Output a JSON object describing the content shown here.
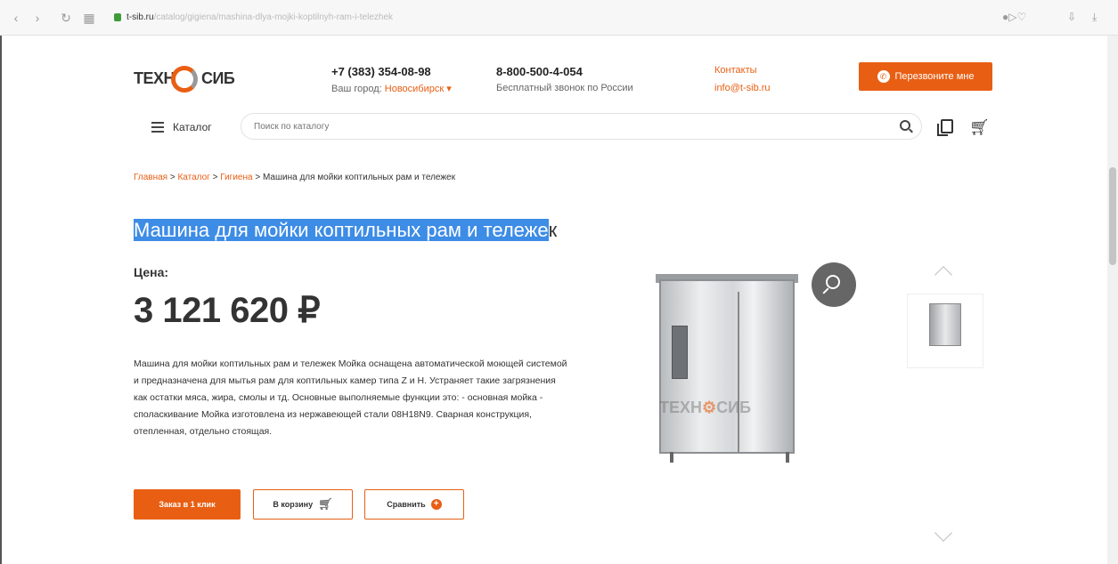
{
  "browser": {
    "host": "t-sib.ru",
    "path": "/catalog/gigiena/mashina-dlya-mojki-koptilnyh-ram-i-telezhek",
    "back_icon": "back-arrow-icon",
    "forward_icon": "forward-arrow-icon",
    "reload_icon": "reload-icon"
  },
  "header": {
    "logo_left": "ТЕХН",
    "logo_right": "СИБ",
    "phone_main": "+7 (383) 354-08-98",
    "city_label": "Ваш город:",
    "city_value": "Новосибирск",
    "phone_free": "8-800-500-4-054",
    "free_call_label": "Бесплатный звонок по России",
    "contacts_label": "Контакты",
    "email": "info@t-sib.ru",
    "callback_label": "Перезвоните мне"
  },
  "nav": {
    "catalog_label": "Каталог",
    "search_placeholder": "Поиск по каталогу"
  },
  "breadcrumb": {
    "home": "Главная",
    "catalog": "Каталог",
    "category": "Гигиена",
    "current": "Машина для мойки коптильных рам и тележек",
    "separator": " > "
  },
  "product": {
    "title_selected": "Машина для мойки коптильных рам и тележе",
    "title_rest": "к",
    "price_label": "Цена:",
    "price_value": "3 121 620 ₽",
    "description": "Машина для мойки коптильных рам и тележек Мойка оснащена автоматической моющей системой и предназначена для мытья рам для коптильных камер типа Z и H. Устраняет такие загрязнения как остатки мяса, жира, смолы и тд. Основные выполняемые функции это: - основная мойка - споласкивание Мойка изготовлена из нержавеющей стали 08Н18N9. Сварная конструкция, отепленная, отдельно стоящая.",
    "watermark_left": "ТЕХН",
    "watermark_right": "СИБ"
  },
  "buttons": {
    "order_label": "Заказ в 1 клик",
    "cart_label": "В корзину",
    "compare_label": "Сравнить"
  },
  "colors": {
    "accent": "#e85f14",
    "selection": "#3d8ce6",
    "text": "#333333"
  }
}
